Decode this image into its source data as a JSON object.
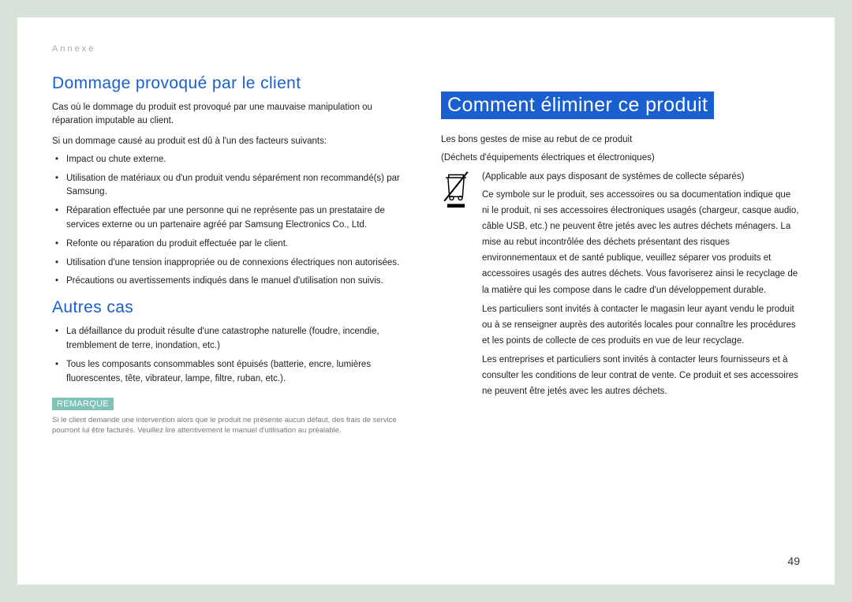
{
  "header": {
    "annex": "Annexe"
  },
  "left": {
    "h1": "Dommage provoqué par le client",
    "intro": "Cas où le dommage du produit est provoqué par une mauvaise manipulation ou réparation imputable au client.",
    "intro2": "Si un dommage causé au produit est dû à l'un des facteurs suivants:",
    "bullets1": [
      "Impact ou chute externe.",
      "Utilisation de matériaux ou d'un produit vendu séparément non recommandé(s) par Samsung.",
      "Réparation effectuée par une personne qui ne représente pas un prestataire de services externe ou un partenaire agréé par Samsung Electronics Co., Ltd.",
      "Refonte ou réparation du produit effectuée par le client.",
      "Utilisation d'une tension inappropriée ou de connexions électriques non autorisées.",
      "Précautions ou avertissements indiqués dans le manuel d'utilisation non suivis."
    ],
    "h2": "Autres cas",
    "bullets2": [
      "La défaillance du produit résulte d'une catastrophe naturelle (foudre, incendie, tremblement de terre, inondation, etc.)",
      "Tous les composants consommables sont épuisés (batterie, encre, lumières fluorescentes, tête, vibrateur, lampe, filtre, ruban, etc.)."
    ],
    "remark_label": "REMARQUE",
    "remark_text": "Si le client demande une intervention alors que le produit ne présente aucun défaut, des frais de service pourront lui être facturés. Veuillez lire attentivement le manuel d'utilisation au préalable."
  },
  "right": {
    "h1": "Comment éliminer ce produit",
    "line1": "Les bons gestes de mise au rebut de ce produit",
    "line2": "(Déchets d'équipements électriques et électroniques)",
    "applicable": "(Applicable aux pays disposant de systèmes de collecte séparés)",
    "para1": "Ce symbole sur le produit, ses accessoires ou sa documentation indique que ni le produit, ni ses accessoires électroniques usagés (chargeur, casque audio, câble USB, etc.) ne peuvent être jetés avec les autres déchets ménagers. La mise au rebut incontrôlée des déchets présentant des risques environnementaux et de santé publique, veuillez séparer vos produits et accessoires usagés des autres déchets. Vous favoriserez ainsi le recyclage de la matière qui les compose dans le cadre d'un développement durable.",
    "para2": "Les particuliers sont invités à contacter le magasin leur ayant vendu le produit ou à se renseigner auprès des autorités locales pour connaître les procédures et les points de collecte de ces produits en vue de leur recyclage.",
    "para3": "Les entreprises et particuliers sont invités à contacter leurs fournisseurs et à consulter les conditions de leur contrat de vente. Ce produit et ses accessoires ne peuvent être jetés avec les autres déchets."
  },
  "page_number": "49"
}
